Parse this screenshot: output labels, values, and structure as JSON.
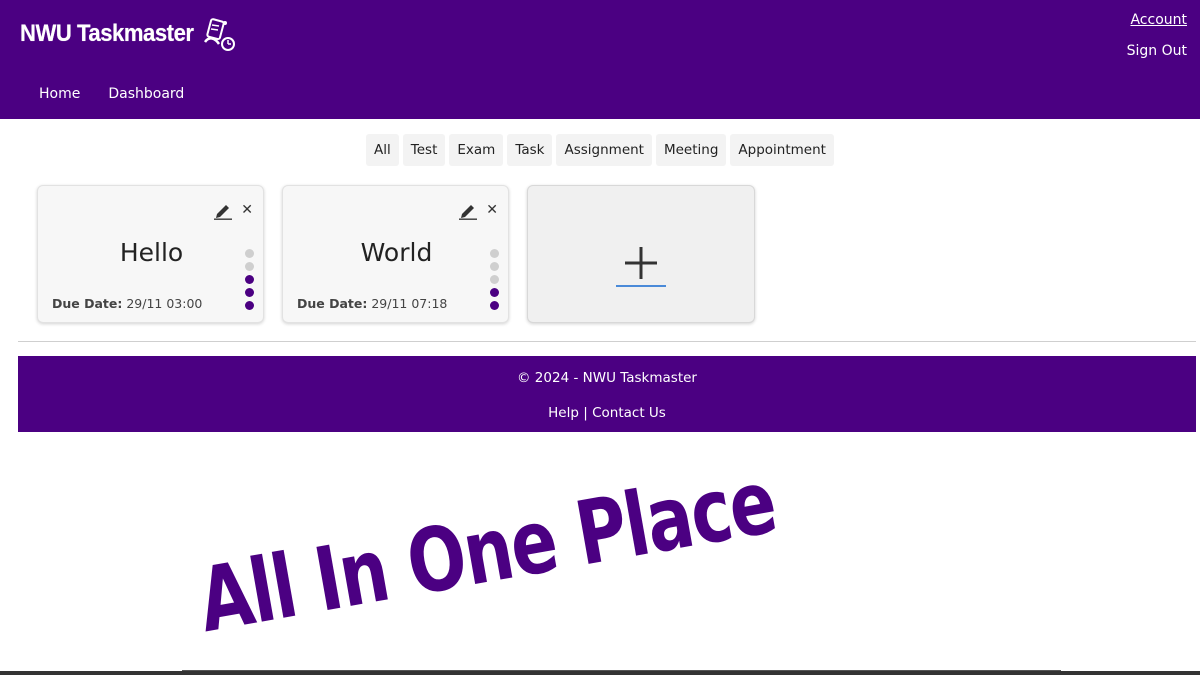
{
  "header": {
    "brand": "NWU Taskmaster",
    "account_label": "Account",
    "signout_label": "Sign Out",
    "nav": [
      {
        "label": "Home"
      },
      {
        "label": "Dashboard"
      }
    ]
  },
  "filters": [
    "All",
    "Test",
    "Exam",
    "Task",
    "Assignment",
    "Meeting",
    "Appointment"
  ],
  "cards": [
    {
      "title": "Hello",
      "due_label": "Due Date:",
      "due_value": "29/11 03:00",
      "level": 3,
      "max_level": 5
    },
    {
      "title": "World",
      "due_label": "Due Date:",
      "due_value": "29/11 07:18",
      "level": 2,
      "max_level": 5
    }
  ],
  "add_card": {
    "icon": "plus-icon"
  },
  "footer": {
    "copyright": "© 2024 - NWU Taskmaster",
    "help": "Help",
    "separator": "|",
    "contact": "Contact Us"
  },
  "slogan": "All In One Place",
  "colors": {
    "brand": "#4b0082",
    "dot_inactive": "#cfcfcf",
    "add_underline": "#4a8ad8"
  },
  "icons": {
    "logo": "taskmaster-logo-icon",
    "edit": "pencil-icon",
    "close": "close-icon"
  }
}
